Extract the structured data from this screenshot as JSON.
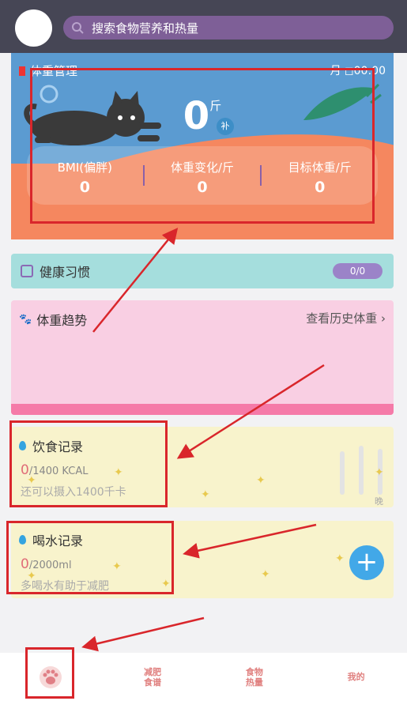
{
  "search": {
    "placeholder": "搜索食物营养和热量"
  },
  "hero": {
    "title": "体重管理",
    "sleep": "月 ◻00:00",
    "weight": "0",
    "unit": "斤",
    "supplement": "补",
    "stats": [
      {
        "label": "BMI(偏胖)",
        "value": "0"
      },
      {
        "label": "体重变化/斤",
        "value": "0"
      },
      {
        "label": "目标体重/斤",
        "value": "0"
      }
    ]
  },
  "habit": {
    "label": "健康习惯",
    "badge": "0/0"
  },
  "trend": {
    "title": "体重趋势",
    "link": "查看历史体重",
    "chevron": "›"
  },
  "diet": {
    "title": "饮食记录",
    "current": "0",
    "goal": "/1400 KCAL",
    "hint": "还可以摄入1400千卡",
    "bar_labels": [
      "",
      "晚"
    ]
  },
  "water": {
    "title": "喝水记录",
    "current": "0",
    "goal": "/2000ml",
    "hint": "多喝水有助于减肥"
  },
  "tabs": [
    {
      "label": "",
      "icon": "paw-icon"
    },
    {
      "label": "减肥\n食谱",
      "icon": ""
    },
    {
      "label": "食物\n热量",
      "icon": ""
    },
    {
      "label": "我的",
      "icon": ""
    }
  ],
  "colors": {
    "topbar": "#464655",
    "search": "#7e5f97",
    "hero_sky": "#5b9bd1",
    "hero_body": "#f5875f",
    "habit_bg": "#a5dedd",
    "trend_bg": "#f9cfe3",
    "card_bg": "#f8f3cc",
    "annotation": "#d9262b"
  }
}
